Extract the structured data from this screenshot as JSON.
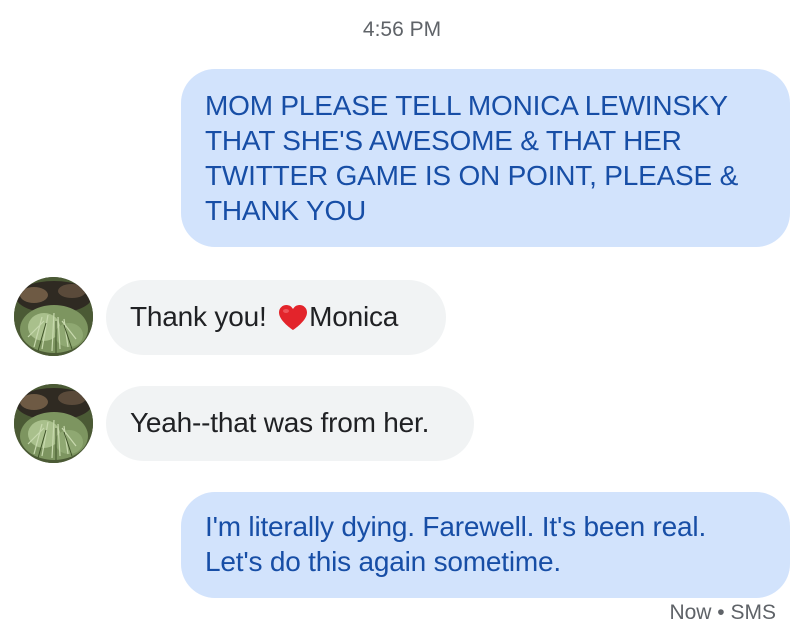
{
  "conversation": {
    "timestamp": "4:56 PM",
    "messages": [
      {
        "direction": "outgoing",
        "text": "MOM PLEASE TELL MONICA LEWINSKY THAT SHE'S AWESOME & THAT HER TWITTER GAME IS ON POINT, PLEASE & THANK YOU"
      },
      {
        "direction": "incoming",
        "text_before": "Thank you! ",
        "emoji": "heart-icon",
        "text_after": "Monica"
      },
      {
        "direction": "incoming",
        "text": "Yeah--that was from her."
      },
      {
        "direction": "outgoing",
        "text": "I'm literally dying. Farewell. It's been real. Let's do this again sometime."
      }
    ],
    "status": "Now • SMS"
  },
  "colors": {
    "outgoing_bubble": "#d2e3fc",
    "outgoing_text": "#174ea6",
    "incoming_bubble": "#f1f3f4",
    "incoming_text": "#202124",
    "meta_text": "#5f6368",
    "heart": "#e3242b"
  }
}
